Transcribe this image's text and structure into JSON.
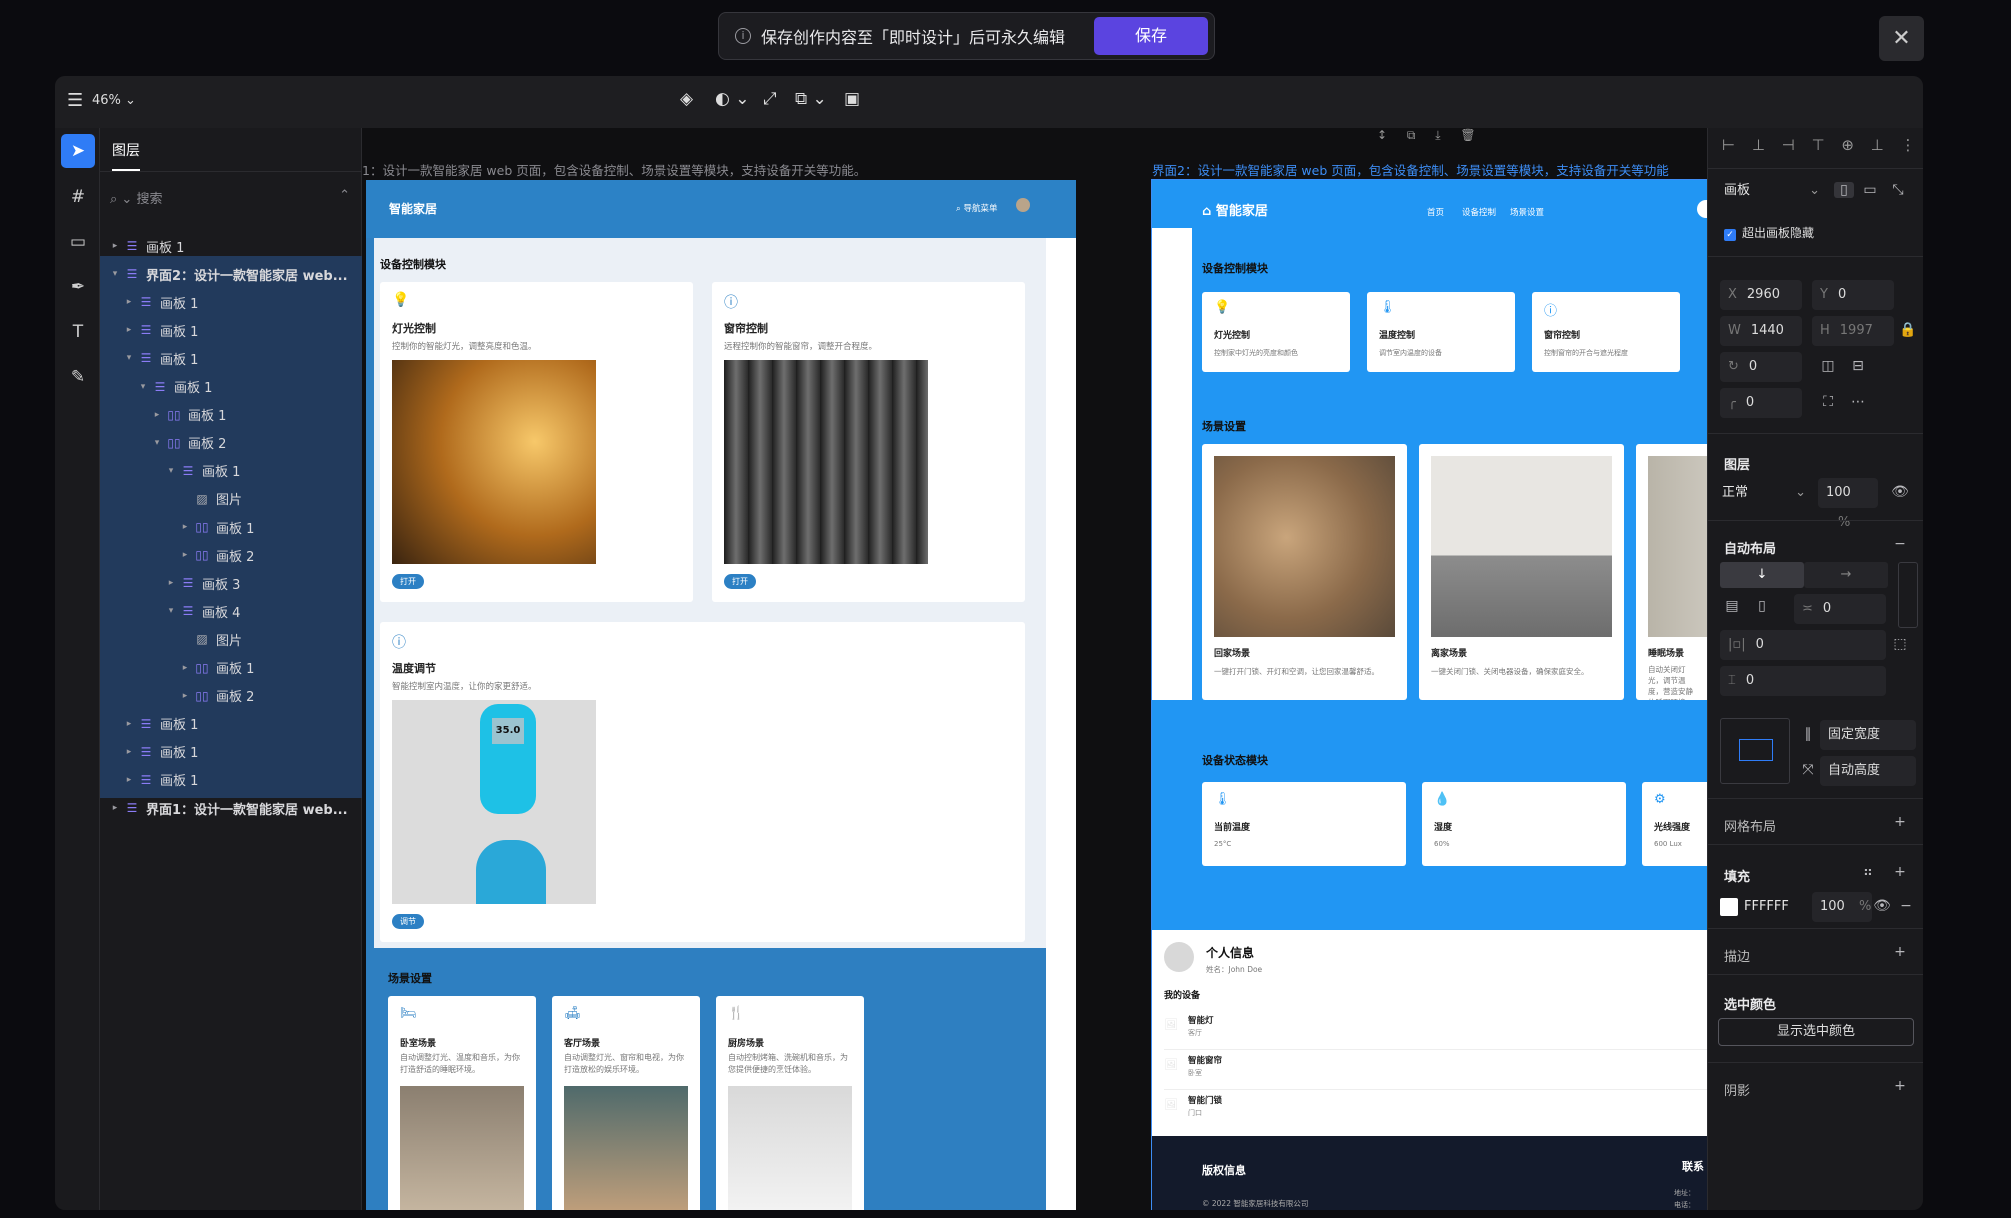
{
  "banner": {
    "message": "保存创作内容至「即时设计」后可永久编辑",
    "save": "保存"
  },
  "topbar": {
    "zoom": "46%"
  },
  "layers": {
    "tab": "图层",
    "search_placeholder": "搜索",
    "rows": [
      {
        "label": "画板 1"
      },
      {
        "label": "界面2：设计一款智能家居 web..."
      },
      {
        "label": "画板 1"
      },
      {
        "label": "画板 1"
      },
      {
        "label": "画板 1"
      },
      {
        "label": "画板 1"
      },
      {
        "label": "画板 1"
      },
      {
        "label": "画板 2"
      },
      {
        "label": "画板 1"
      },
      {
        "label": "图片"
      },
      {
        "label": "画板 1"
      },
      {
        "label": "画板 2"
      },
      {
        "label": "画板 3"
      },
      {
        "label": "画板 4"
      },
      {
        "label": "图片"
      },
      {
        "label": "画板 1"
      },
      {
        "label": "画板 2"
      },
      {
        "label": "画板 1"
      },
      {
        "label": "画板 1"
      },
      {
        "label": "画板 1"
      },
      {
        "label": "界面1：设计一款智能家居 web..."
      }
    ]
  },
  "canvas": {
    "label1": "1：设计一款智能家居 web 页面，包含设备控制、场景设置等模块，支持设备开关等功能。",
    "label2": "界面2：设计一款智能家居 web 页面，包含设备控制、场景设置等模块，支持设备开关等功能",
    "f1": {
      "brand": "智能家居",
      "search": "导航菜单",
      "section1": "设备控制模块",
      "cards": [
        {
          "title": "灯光控制",
          "desc": "控制你的智能灯光，调整亮度和色温。",
          "btn": "打开"
        },
        {
          "title": "窗帘控制",
          "desc": "远程控制你的智能窗帘，调整开合程度。",
          "btn": "打开"
        },
        {
          "title": "温度调节",
          "desc": "智能控制室内温度，让你的家更舒适。",
          "btn": "调节",
          "reading": "35.0"
        }
      ],
      "section2": "场景设置",
      "scenes": [
        {
          "title": "卧室场景",
          "desc": "自动调整灯光、温度和音乐，为你打造舒适的睡眠环境。"
        },
        {
          "title": "客厅场景",
          "desc": "自动调整灯光、窗帘和电视，为你打造放松的娱乐环境。"
        },
        {
          "title": "厨房场景",
          "desc": "自动控制烤箱、洗碗机和音乐，为您提供便捷的烹饪体验。"
        }
      ]
    },
    "f2": {
      "brand": "智能家居",
      "nav": [
        "首页",
        "设备控制",
        "场景设置"
      ],
      "section1": "设备控制模块",
      "devices": [
        {
          "title": "灯光控制",
          "desc": "控制家中灯光的亮度和颜色"
        },
        {
          "title": "温度控制",
          "desc": "调节室内温度的设备"
        },
        {
          "title": "窗帘控制",
          "desc": "控制窗帘的开合与遮光程度"
        }
      ],
      "section2": "场景设置",
      "scenes": [
        {
          "title": "回家场景",
          "desc": "一键打开门锁、开灯和空调，让您回家温馨舒适。"
        },
        {
          "title": "离家场景",
          "desc": "一键关闭门锁、关闭电器设备，确保家庭安全。"
        },
        {
          "title": "睡眠场景",
          "desc": "自动关闭灯光，调节温度，营造安静的睡眠环境。"
        }
      ],
      "section3": "设备状态模块",
      "status": [
        {
          "title": "当前温度",
          "value": "25°C"
        },
        {
          "title": "湿度",
          "value": "60%"
        },
        {
          "title": "光线强度",
          "value": "600 Lux"
        }
      ],
      "profile": {
        "title": "个人信息",
        "name": "姓名：John Doe",
        "devices_title": "我的设备",
        "devices": [
          {
            "name": "智能灯",
            "room": "客厅"
          },
          {
            "name": "智能窗帘",
            "room": "卧室"
          },
          {
            "name": "智能门锁",
            "room": "门口"
          }
        ]
      },
      "footer": {
        "title": "版权信息",
        "copyright": "© 2022 智能家居科技有限公司",
        "contact": "联系",
        "addr": "地址：",
        "phone": "电话："
      }
    }
  },
  "props": {
    "frame_type": "画板",
    "clip_label": "超出画板隐藏",
    "x": "2960",
    "y": "0",
    "w": "1440",
    "h": "1997",
    "rotation": "0",
    "radius": "0",
    "layer_title": "图层",
    "blend": "正常",
    "opacity": "100",
    "pct": "%",
    "autolayout_title": "自动布局",
    "gap": "0",
    "pad_h": "0",
    "pad_v": "0",
    "fixed_width": "固定宽度",
    "auto_height": "自动高度",
    "grid_title": "网格布局",
    "fill_title": "填充",
    "fill_hex": "FFFFFF",
    "fill_opacity": "100",
    "stroke_title": "描边",
    "selcolor_title": "选中颜色",
    "show_selcolor": "显示选中颜色",
    "shadow_title": "阴影"
  }
}
